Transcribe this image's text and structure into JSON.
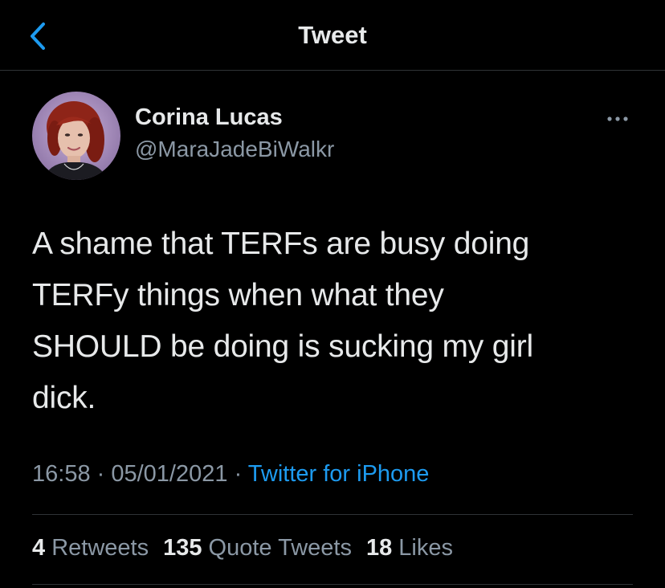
{
  "header": {
    "title": "Tweet",
    "back_icon": "chevron-left-icon",
    "accent_color": "#1d9bf0"
  },
  "author": {
    "name": "Corina Lucas",
    "handle": "@MaraJadeBiWalkr",
    "avatar": "profile-photo",
    "more_icon": "ellipsis-icon"
  },
  "tweet": {
    "lines": [
      "A shame that TERFs are busy doing",
      "TERFy things when what they",
      "SHOULD be doing is sucking my girl",
      "dick."
    ]
  },
  "meta": {
    "time": "16:58",
    "sep1": " · ",
    "date": "05/01/2021",
    "sep2": " · ",
    "source": "Twitter for iPhone"
  },
  "stats": {
    "retweets_count": "4",
    "retweets_label": "Retweets",
    "quotes_count": "135",
    "quotes_label": "Quote Tweets",
    "likes_count": "18",
    "likes_label": "Likes"
  }
}
